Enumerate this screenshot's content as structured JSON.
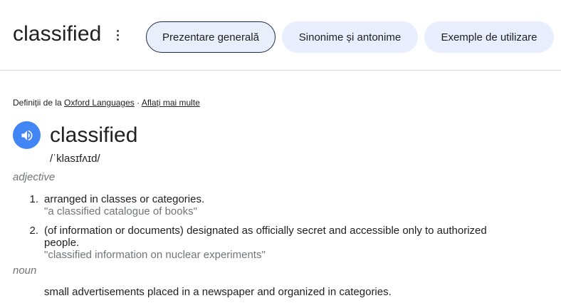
{
  "header": {
    "word": "classified",
    "tabs": [
      {
        "label": "Prezentare generală",
        "active": true
      },
      {
        "label": "Sinonime și antonime",
        "active": false
      },
      {
        "label": "Exemple de utilizare",
        "active": false
      }
    ]
  },
  "source": {
    "prefix": "Definiții de la",
    "provider": "Oxford Languages",
    "separator": "·",
    "more": "Aflați mai multe"
  },
  "entry": {
    "headword": "classified",
    "phonetic": "/ˈklasɪfʌɪd/",
    "speaker_icon": "volume-icon",
    "accent_color": "#4285f4"
  },
  "adjective": {
    "label": "adjective",
    "senses": [
      {
        "num": "1.",
        "definition": "arranged in classes or categories.",
        "example": "\"a classified catalogue of books\""
      },
      {
        "num": "2.",
        "definition": "(of information or documents) designated as officially secret and accessible only to authorized people.",
        "example": "\"classified information on nuclear experiments\""
      }
    ]
  },
  "noun": {
    "label": "noun",
    "senses": [
      {
        "definition": "small advertisements placed in a newspaper and organized in categories."
      }
    ]
  }
}
